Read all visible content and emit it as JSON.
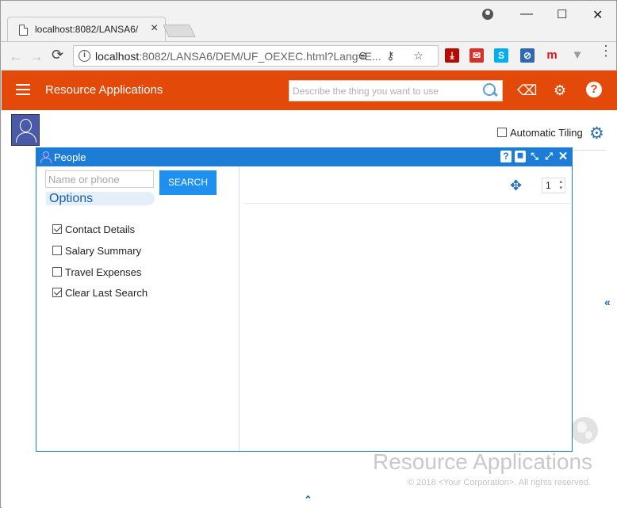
{
  "browser": {
    "tab_title": "localhost:8082/LANSA6/",
    "tab_close": "×",
    "window_controls": {
      "minimize": "—",
      "maximize": "☐",
      "close": "✕"
    },
    "nav": {
      "back": "←",
      "forward": "→",
      "reload": "⟳"
    },
    "url_host": "localhost",
    "url_rest": ":8082/LANSA6/DEM/UF_OEXEC.html?Lang=E...",
    "omnibox_icons": "⊖ ⚷ ☆",
    "extensions": [
      {
        "name": "pdf",
        "label": "⤓",
        "color": "#b30b00"
      },
      {
        "name": "mail",
        "label": "✉",
        "color": "#d6312b"
      },
      {
        "name": "skype",
        "label": "S",
        "color": "#00aff0"
      },
      {
        "name": "blocker",
        "label": "⊘",
        "color": "#2d6ab3"
      },
      {
        "name": "m",
        "label": "m",
        "color": "#e0141e"
      },
      {
        "name": "funnel",
        "label": "▼",
        "color": "#9a9a9a"
      }
    ],
    "menu": "⋮"
  },
  "appbar": {
    "title": "Resource Applications",
    "search_placeholder": "Describe the thing you want to use",
    "eraser_icon": "⌫",
    "gear_icon": "⚙",
    "help_icon": "?"
  },
  "toolbar": {
    "automatic_tiling_label": "Automatic Tiling",
    "automatic_tiling_checked": false,
    "settings_icon": "⚙"
  },
  "people_window": {
    "title": "People",
    "controls": {
      "help": "?",
      "hide": "⯀",
      "shrink": "⤡",
      "expand": "⤢",
      "close": "✕"
    },
    "name_placeholder": "Name or phone",
    "search_label": "SEARCH",
    "options_heading": "Options",
    "options": [
      {
        "label": "Contact Details",
        "checked": true
      },
      {
        "label": "Salary Summary",
        "checked": false
      },
      {
        "label": "Travel Expenses",
        "checked": false
      },
      {
        "label": "Clear Last Search",
        "checked": true
      }
    ],
    "move_icon": "✥",
    "page_value": "1",
    "spinner_arrows": "▲▼"
  },
  "branding": {
    "title": "Resource Applications",
    "copyright": "© 2018 <Your Corporation>. All rights reserved."
  },
  "side_toggles": {
    "left_chevron": "«",
    "up_chevron": "⌃"
  },
  "colors": {
    "appbar": "#e34a0a",
    "window_header": "#1c7cd6",
    "search_button": "#1e90f0"
  }
}
